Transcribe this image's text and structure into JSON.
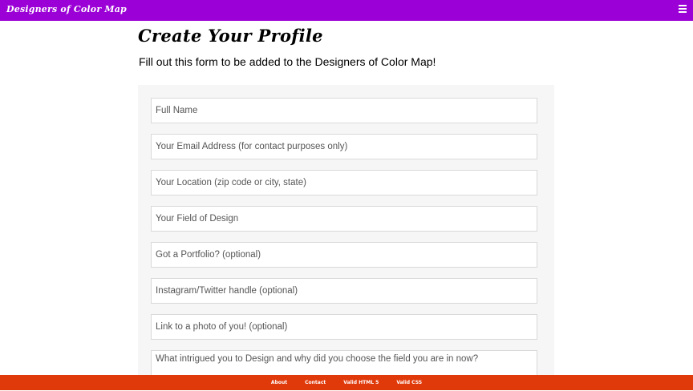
{
  "header": {
    "brand": "Designers of Color Map",
    "menu_icon": "hamburger-menu-icon"
  },
  "main": {
    "title": "Create Your Profile",
    "intro": "Fill out this form to be added to the Designers of Color Map!"
  },
  "form": {
    "full_name": {
      "placeholder": "Full Name",
      "value": ""
    },
    "email": {
      "placeholder": "Your Email Address (for contact purposes only)",
      "value": ""
    },
    "location": {
      "placeholder": "Your Location (zip code or city, state)",
      "value": ""
    },
    "field_of_design": {
      "placeholder": "Your Field of Design",
      "value": ""
    },
    "portfolio": {
      "placeholder": "Got a Portfolio? (optional)",
      "value": ""
    },
    "social": {
      "placeholder": "Instagram/Twitter handle (optional)",
      "value": ""
    },
    "photo": {
      "placeholder": "Link to a photo of you! (optional)",
      "value": ""
    },
    "why_design": {
      "placeholder": "What intrigued you to Design and why did you choose the field you are in now?",
      "value": ""
    }
  },
  "footer": {
    "links": [
      "About",
      "Contact",
      "Valid HTML 5",
      "Valid CSS"
    ]
  },
  "colors": {
    "header_bg": "#9b00d6",
    "footer_bg": "#e03a0b",
    "form_panel_bg": "#f6f6f6"
  }
}
